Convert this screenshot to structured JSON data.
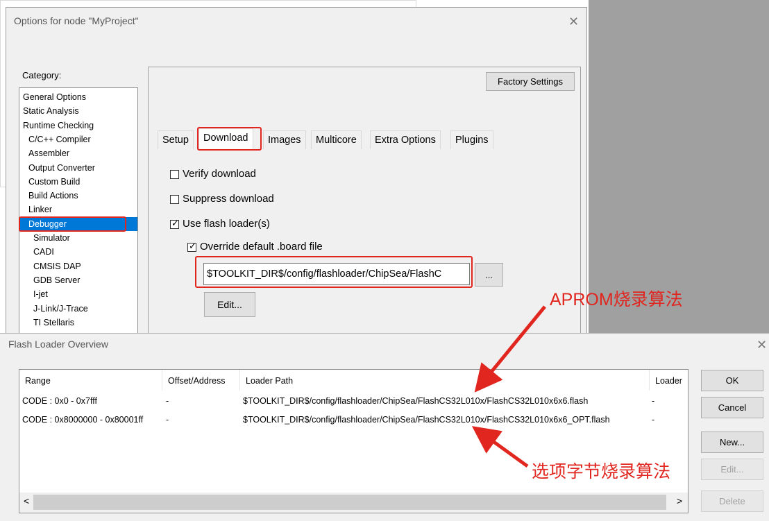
{
  "options_dialog": {
    "title": "Options for node \"MyProject\"",
    "category_label": "Category:",
    "categories": [
      {
        "label": "General Options",
        "indent": 0
      },
      {
        "label": "Static Analysis",
        "indent": 0
      },
      {
        "label": "Runtime Checking",
        "indent": 0
      },
      {
        "label": "C/C++ Compiler",
        "indent": 1
      },
      {
        "label": "Assembler",
        "indent": 1
      },
      {
        "label": "Output Converter",
        "indent": 1
      },
      {
        "label": "Custom Build",
        "indent": 1
      },
      {
        "label": "Build Actions",
        "indent": 1
      },
      {
        "label": "Linker",
        "indent": 1
      },
      {
        "label": "Debugger",
        "indent": 1,
        "selected": true
      },
      {
        "label": "Simulator",
        "indent": 2
      },
      {
        "label": "CADI",
        "indent": 2
      },
      {
        "label": "CMSIS DAP",
        "indent": 2
      },
      {
        "label": "GDB Server",
        "indent": 2
      },
      {
        "label": "I-jet",
        "indent": 2
      },
      {
        "label": "J-Link/J-Trace",
        "indent": 2
      },
      {
        "label": "TI Stellaris",
        "indent": 2
      }
    ],
    "factory_settings": "Factory Settings",
    "tabs": [
      "Setup",
      "Download",
      "Images",
      "Multicore",
      "Extra Options",
      "Plugins"
    ],
    "active_tab": "Download",
    "verify_download": {
      "label": "Verify download",
      "checked": false
    },
    "suppress_download": {
      "label": "Suppress download",
      "checked": false
    },
    "use_flash_loader": {
      "label": "Use flash loader(s)",
      "checked": true
    },
    "override_board": {
      "label": "Override default .board file",
      "checked": true
    },
    "board_file_path": "$TOOLKIT_DIR$/config/flashloader/ChipSea/FlashC",
    "browse_button": "...",
    "edit_button": "Edit..."
  },
  "flash_loader_dialog": {
    "title": "Flash Loader Overview",
    "columns": [
      "Range",
      "Offset/Address",
      "Loader Path",
      "Loader"
    ],
    "rows": [
      {
        "range": "CODE : 0x0 - 0x7fff",
        "offset": "-",
        "path": "$TOOLKIT_DIR$/config/flashloader/ChipSea/FlashCS32L010x/FlashCS32L010x6x6.flash",
        "loader": "-"
      },
      {
        "range": "CODE : 0x8000000 - 0x80001ff",
        "offset": "-",
        "path": "$TOOLKIT_DIR$/config/flashloader/ChipSea/FlashCS32L010x/FlashCS32L010x6x6_OPT.flash",
        "loader": "-"
      }
    ],
    "buttons": {
      "ok": "OK",
      "cancel": "Cancel",
      "new": "New...",
      "edit": "Edit...",
      "delete": "Delete"
    },
    "scroll_left": "<",
    "scroll_right": ">"
  },
  "annotations": {
    "aprom": "APROM烧录算法",
    "option_bytes": "选项字节烧录算法",
    "color": "#e0261f"
  }
}
